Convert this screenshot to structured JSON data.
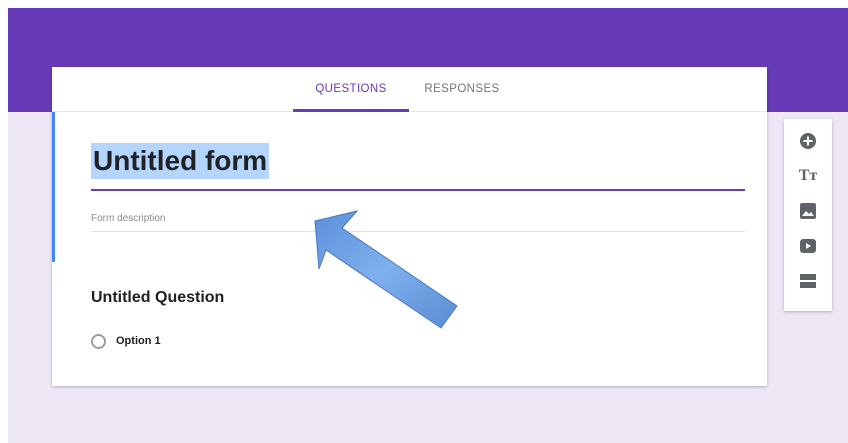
{
  "tabs": {
    "questions": "QUESTIONS",
    "responses": "RESPONSES"
  },
  "form": {
    "title": "Untitled form",
    "description_placeholder": "Form description"
  },
  "question": {
    "title": "Untitled Question",
    "options": [
      "Option 1"
    ]
  },
  "toolbar": {
    "icons": [
      "add-question-icon",
      "title-text-icon",
      "image-icon",
      "video-icon",
      "section-icon"
    ],
    "title_icon_glyph": "Tт"
  },
  "colors": {
    "header": "#673ab7",
    "page_background": "#ede7f6",
    "selection_highlight": "#b4d5fe",
    "focus_accent": "#4285f4",
    "arrow": "#6fa3e6"
  }
}
